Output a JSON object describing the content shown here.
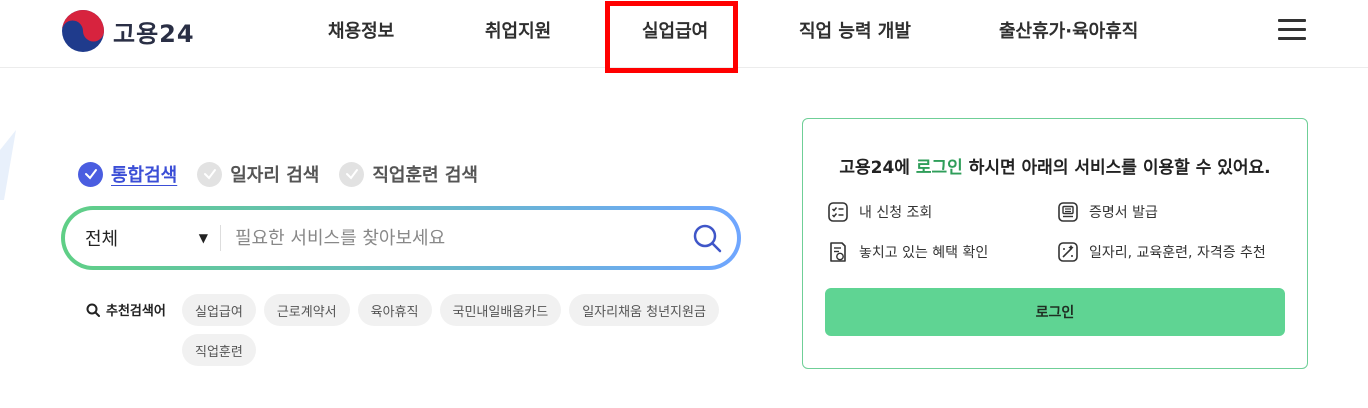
{
  "header": {
    "logo_text": "고용24",
    "nav": [
      "채용정보",
      "취업지원",
      "실업급여",
      "직업 능력 개발",
      "출산휴가·육아휴직"
    ]
  },
  "search": {
    "tabs": [
      {
        "label": "통합검색",
        "active": true
      },
      {
        "label": "일자리 검색",
        "active": false
      },
      {
        "label": "직업훈련 검색",
        "active": false
      }
    ],
    "select_value": "전체",
    "placeholder": "필요한 서비스를 찾아보세요",
    "recommend_label": "추천검색어",
    "chips": [
      "실업급여",
      "근로계약서",
      "육아휴직",
      "국민내일배움카드",
      "일자리채움 청년지원금",
      "직업훈련"
    ]
  },
  "login_card": {
    "title_pre": "고용24에 ",
    "title_link": "로그인",
    "title_post": " 하시면 아래의 서비스를 이용할 수 있어요.",
    "services": [
      "내 신청 조회",
      "증명서 발급",
      "놓치고 있는 혜택 확인",
      "일자리, 교육훈련, 자격증 추천"
    ],
    "button_label": "로그인"
  },
  "colors": {
    "accent_blue": "#4a5de0",
    "accent_green": "#5fd493",
    "highlight_red": "#ff0000"
  }
}
